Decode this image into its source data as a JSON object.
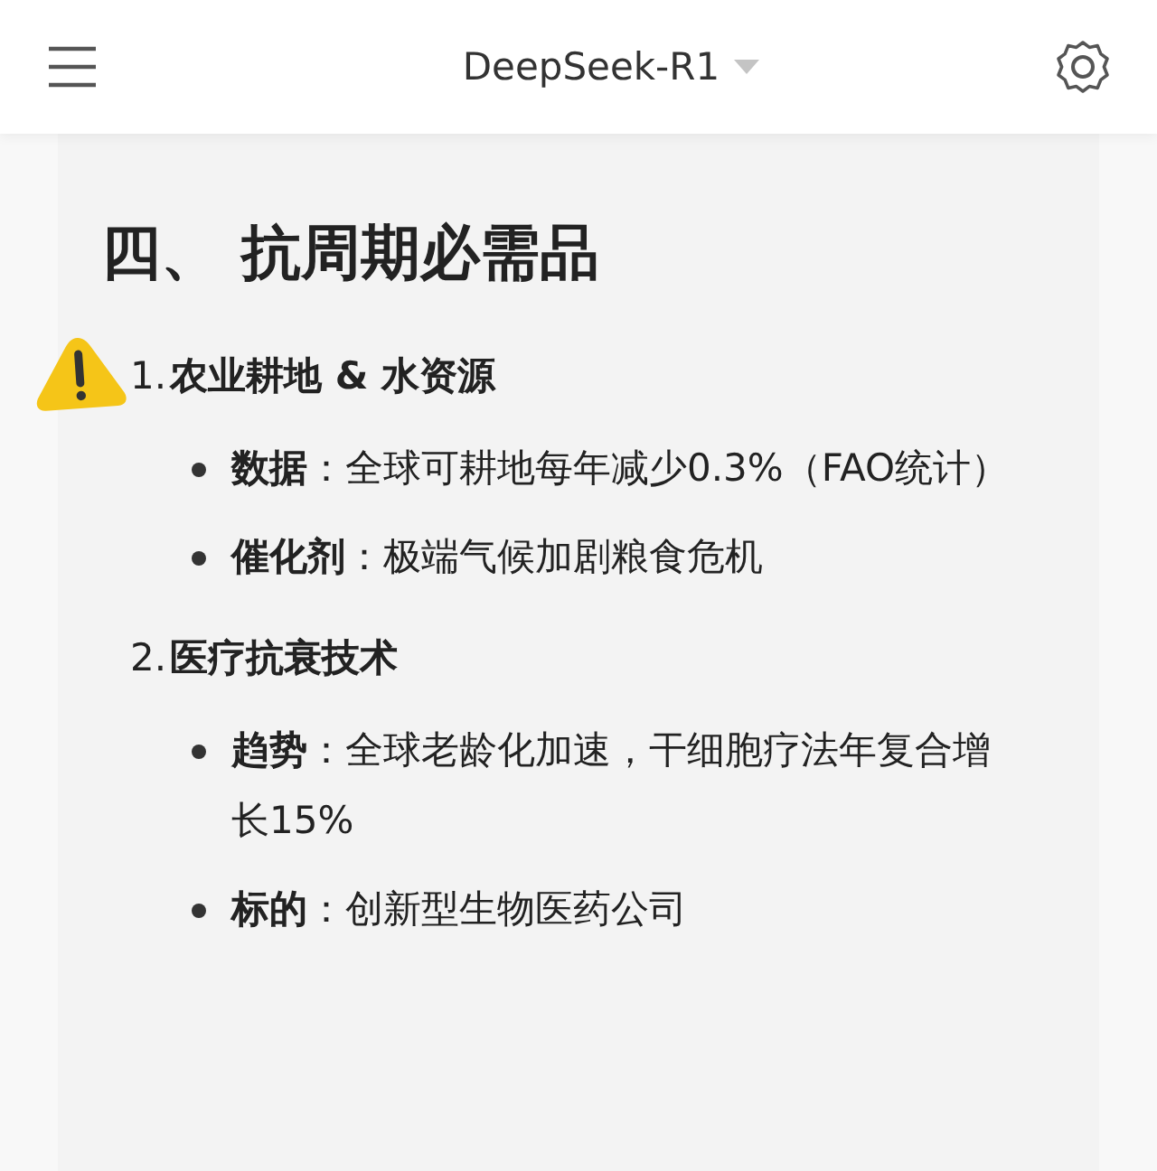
{
  "header": {
    "title": "DeepSeek-R1"
  },
  "section": {
    "heading": "四、 抗周期必需品",
    "items": [
      {
        "number": "1.",
        "title": "农业耕地 & 水资源",
        "warning": true,
        "bullets": [
          "**数据**：全球可耕地每年减少0.3%（FAO统计）",
          "**催化剂**：极端气候加剧粮食危机"
        ]
      },
      {
        "number": "2.",
        "title": "医疗抗衰技术",
        "warning": false,
        "bullets": [
          "**趋势**：全球老龄化加速，干细胞疗法年复合增长15%",
          "**标的**：创新型生物医药公司"
        ]
      }
    ]
  }
}
